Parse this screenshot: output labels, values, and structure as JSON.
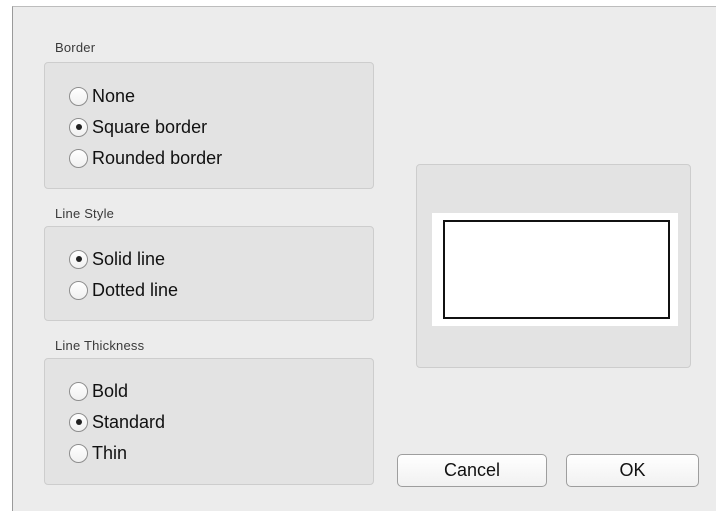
{
  "border": {
    "title": "Border",
    "options": [
      {
        "label": "None",
        "selected": false
      },
      {
        "label": "Square border",
        "selected": true
      },
      {
        "label": "Rounded border",
        "selected": false
      }
    ]
  },
  "line_style": {
    "title": "Line Style",
    "options": [
      {
        "label": "Solid line",
        "selected": true
      },
      {
        "label": "Dotted line",
        "selected": false
      }
    ]
  },
  "line_thickness": {
    "title": "Line Thickness",
    "options": [
      {
        "label": "Bold",
        "selected": false
      },
      {
        "label": "Standard",
        "selected": true
      },
      {
        "label": "Thin",
        "selected": false
      }
    ]
  },
  "buttons": {
    "cancel": "Cancel",
    "ok": "OK"
  },
  "colors": {
    "dialog_background": "#ececec",
    "group_background": "#e3e3e3",
    "preview_stroke": "#111111"
  }
}
